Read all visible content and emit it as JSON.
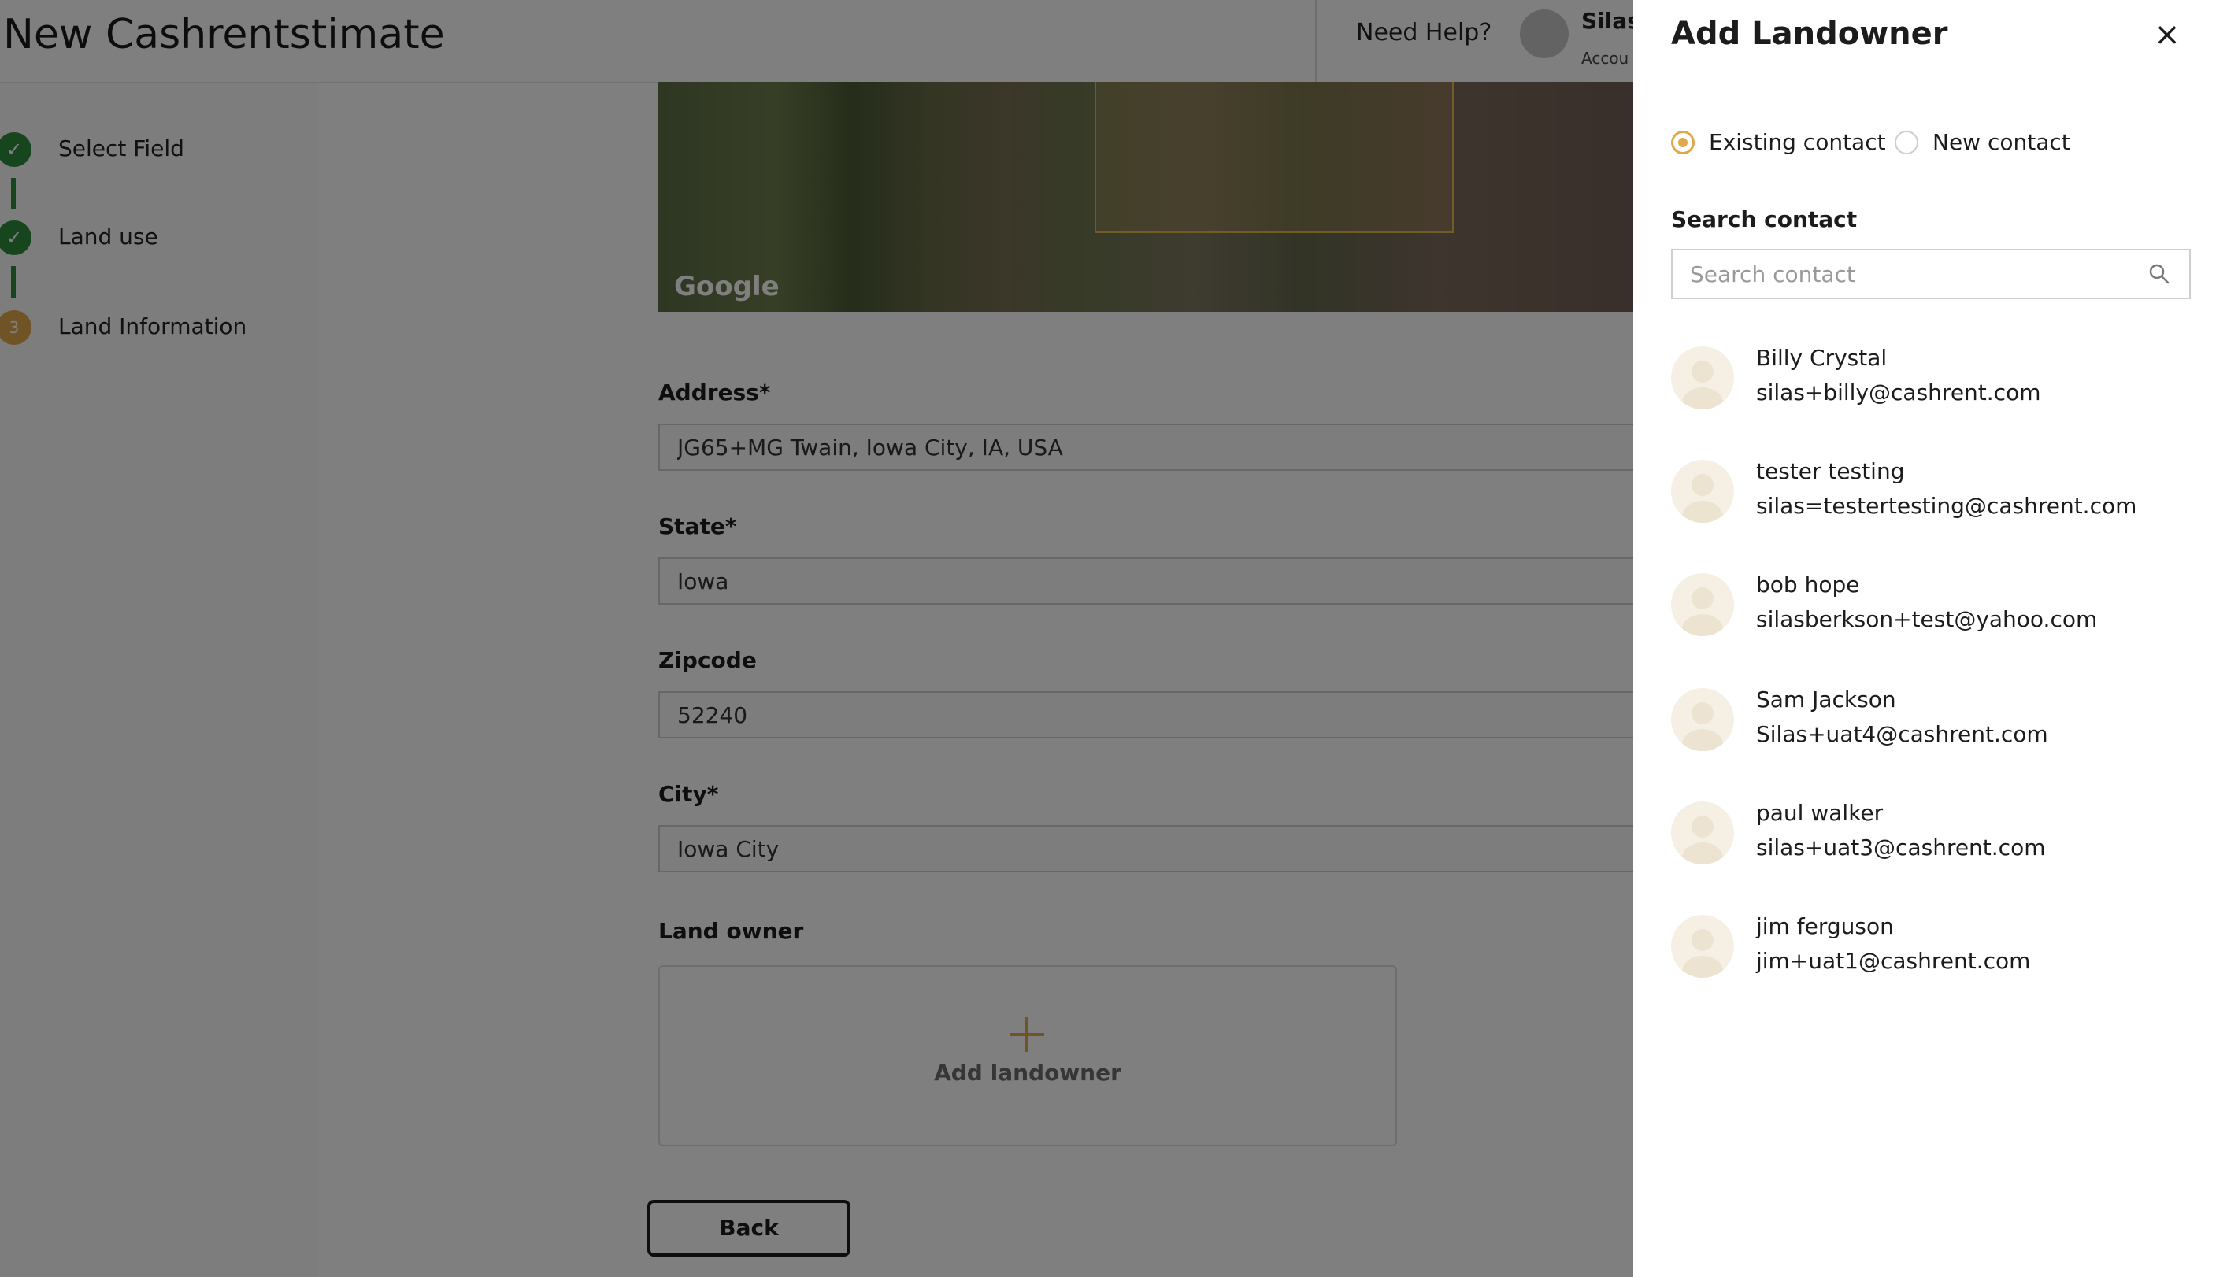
{
  "header": {
    "title": "New Cashrentstimate",
    "help_label": "Need Help?",
    "user_name": "Silas",
    "user_sub": "Accou"
  },
  "sidebar": {
    "steps": [
      {
        "label": "Select Field",
        "status": "done"
      },
      {
        "label": "Land use",
        "status": "done"
      },
      {
        "label": "Land Information",
        "status": "current",
        "number": "3"
      }
    ]
  },
  "map": {
    "logo": "Google"
  },
  "form": {
    "address": {
      "label": "Address",
      "required": "*",
      "value": "JG65+MG Twain, Iowa City, IA, USA"
    },
    "state": {
      "label": "State",
      "required": "*",
      "value": "Iowa"
    },
    "zipcode": {
      "label": "Zipcode",
      "value": "52240"
    },
    "city": {
      "label": "City",
      "required": "*",
      "value": "Iowa City"
    },
    "land_owner": {
      "label": "Land owner",
      "add_label": "Add landowner"
    },
    "back_label": "Back"
  },
  "drawer": {
    "title": "Add Landowner",
    "close_symbol": "×",
    "radio_existing": "Existing contact",
    "radio_new": "New contact",
    "selected": "Existing contact",
    "search_label": "Search contact",
    "search_placeholder": "Search contact",
    "contacts": [
      {
        "name": "Billy Crystal",
        "email": "silas+billy@cashrent.com"
      },
      {
        "name": "tester testing",
        "email": "silas=testertesting@cashrent.com"
      },
      {
        "name": "bob hope",
        "email": "silasberkson+test@yahoo.com"
      },
      {
        "name": "Sam Jackson",
        "email": "Silas+uat4@cashrent.com"
      },
      {
        "name": "paul walker",
        "email": "silas+uat3@cashrent.com"
      },
      {
        "name": "jim ferguson",
        "email": "jim+uat1@cashrent.com"
      }
    ]
  },
  "colors": {
    "accent": "#e0a84a",
    "success": "#2e8b3a",
    "overlay": "rgba(0,0,0,0.5)"
  }
}
